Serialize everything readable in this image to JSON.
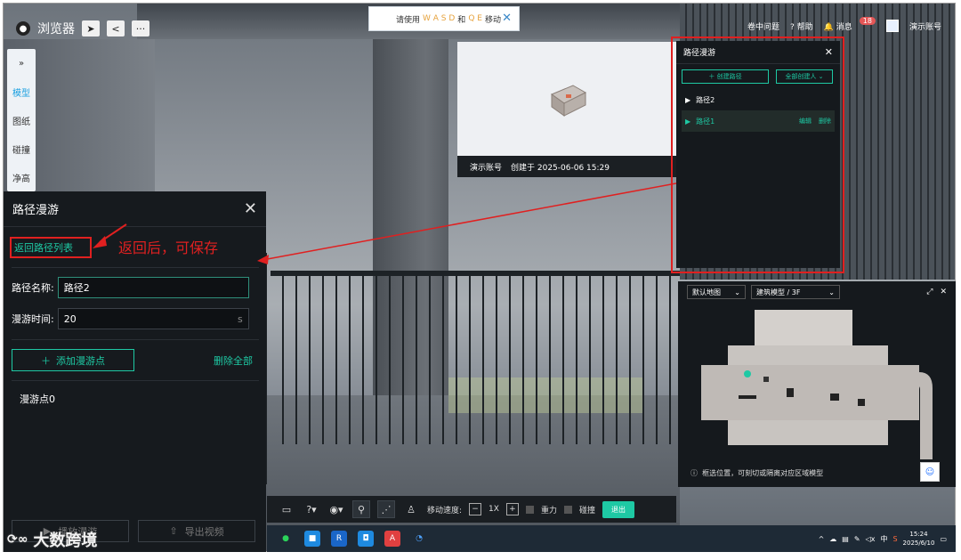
{
  "app": {
    "title": "浏览器"
  },
  "hint": {
    "prefix": "请使用",
    "keys1": "W A S D",
    "and": "和",
    "keys2": "Q E",
    "suffix": "移动"
  },
  "topright": {
    "item1": "卷中问题",
    "help": "帮助",
    "msg": "消息",
    "msg_count": "18",
    "user": "演示账号"
  },
  "vtabs": [
    "»",
    "模型",
    "图纸",
    "碰撞",
    "净高"
  ],
  "left_panel": {
    "title": "路径漫游",
    "back_link": "返回路径列表",
    "name_label": "路径名称:",
    "name_value": "路径2",
    "time_label": "漫游时间:",
    "time_value": "20",
    "time_unit": "s",
    "add_button": "添加漫游点",
    "delete_all": "删除全部",
    "waypoint": "漫游点0",
    "play_button": "播放漫游",
    "export_button": "导出视频"
  },
  "annotation": {
    "text": "返回后，可保存",
    "color": "#e02020"
  },
  "preview": {
    "account": "演示账号",
    "created": "创建于 2025-06-06 15:29"
  },
  "right_panel": {
    "title": "路径漫游",
    "create_button": "创建路径",
    "filter_button": "全部创建人",
    "paths": [
      {
        "name": "路径2",
        "active": false
      },
      {
        "name": "路径1",
        "active": true,
        "edit": "编辑",
        "delete": "删除"
      }
    ]
  },
  "minimap": {
    "map_select": "默认地图",
    "model_select": "建筑模型 / 3F",
    "tip": "框选位置，可刻切或隔离对应区域模型"
  },
  "toolbar": {
    "speed_label": "移动速度:",
    "speed_value": "1X",
    "gravity": "重力",
    "collision": "碰撞",
    "exit": "退出"
  },
  "taskbar": {
    "time": "15:24",
    "date": "2025/6/10",
    "ime": "中"
  },
  "watermark": {
    "text": "大数跨境"
  },
  "colors": {
    "accent": "#1ec9a4",
    "panel_bg": "#161a1e",
    "annotation_red": "#e02020"
  }
}
